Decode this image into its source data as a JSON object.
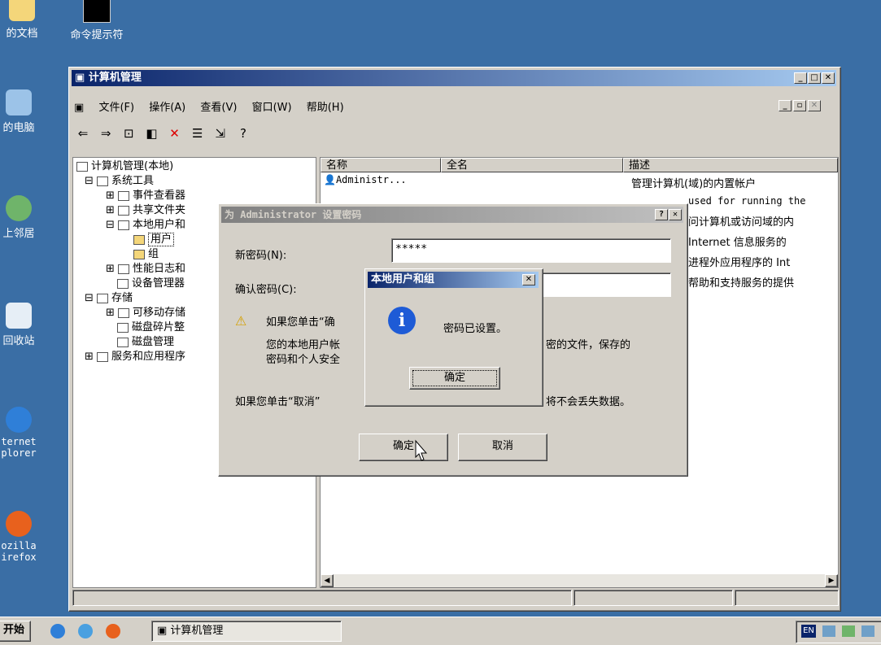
{
  "desktop": {
    "icons": [
      {
        "label": "的文档"
      },
      {
        "label": "命令提示符"
      },
      {
        "label": "的电脑"
      },
      {
        "label": "上邻居"
      },
      {
        "label": "回收站"
      },
      {
        "label": "ternet\nplorer"
      },
      {
        "label": "ozilla\nirefox"
      }
    ]
  },
  "mmc": {
    "title": "计算机管理",
    "menu": [
      "文件(F)",
      "操作(A)",
      "查看(V)",
      "窗口(W)",
      "帮助(H)"
    ],
    "tree": {
      "root": "计算机管理(本地)",
      "items": [
        "系统工具",
        "事件查看器",
        "共享文件夹",
        "本地用户和",
        "用户",
        "组",
        "性能日志和",
        "设备管理器",
        "存储",
        "可移动存储",
        "磁盘碎片整",
        "磁盘管理",
        "服务和应用程序"
      ]
    },
    "list": {
      "columns": [
        "名称",
        "全名",
        "描述"
      ],
      "rows": [
        {
          "name": "Administr...",
          "desc": "管理计算机(域)的内置帐户"
        }
      ],
      "extra_desc": [
        "used for running the",
        "问计算机或访问域的内",
        "Internet 信息服务的",
        "进程外应用程序的 Int",
        "帮助和支持服务的提供"
      ]
    }
  },
  "password_dialog": {
    "title": "为 Administrator 设置密码",
    "new_password_label": "新密码(N):",
    "new_password_value": "*****",
    "confirm_label": "确认密码(C):",
    "warning_line1": "如果您单击“确",
    "warning_line2": "您的本地用户帐",
    "warning_line2_tail": "密的文件，保存的",
    "warning_line3": "密码和个人安全",
    "cancel_line": "如果您单击“取消”",
    "cancel_line_tail": "将不会丢失数据。",
    "ok_button": "确定",
    "cancel_button": "取消"
  },
  "message_box": {
    "title": "本地用户和组",
    "message": "密码已设置。",
    "ok_button": "确定"
  },
  "taskbar": {
    "start": "开始",
    "task": "计算机管理",
    "tray_lang": "EN"
  }
}
